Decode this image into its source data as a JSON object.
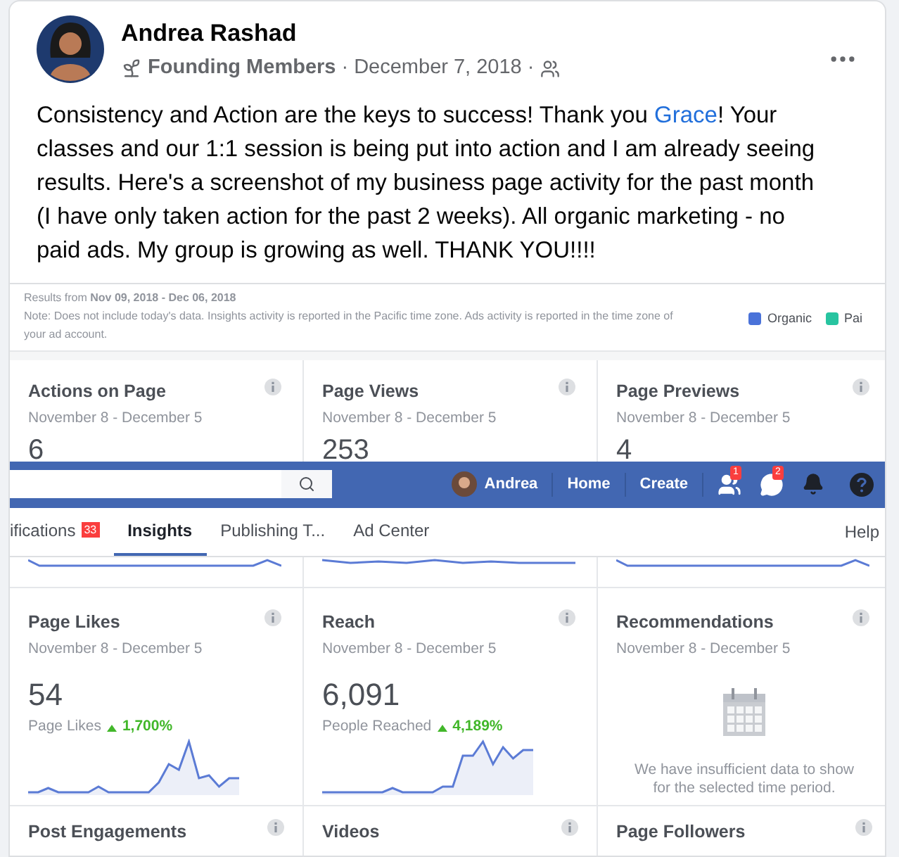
{
  "post": {
    "author": "Andrea Rashad",
    "group": "Founding Members",
    "separator_1": "·",
    "date": "December 7, 2018",
    "separator_2": "·",
    "body_before": "Consistency and Action are the keys to success! Thank you ",
    "mention": "Grace",
    "body_after": "! Your classes and our 1:1 session is being put into action and I am already seeing results. Here's a screenshot of my business page activity for the past month (I have only taken action for the past 2 weeks). All organic marketing - no paid ads. My group is growing as well. THANK YOU!!!!"
  },
  "screenshot": {
    "results": "Results from **Nov 09, 2018 - Dec 06, 2018**",
    "note": "Note: Does not include today's data. Insights activity is reported in the Pacific time zone. Ads activity is reported in the time zone of your ad account.",
    "legend": [
      {
        "label": "Organic",
        "color": "#4a72d9"
      },
      {
        "label": "Pai",
        "color": "#27c4a0"
      }
    ],
    "top_cards": [
      {
        "title": "Actions on Page",
        "dates": "November 8 - December 5",
        "value": "6"
      },
      {
        "title": "Page Views",
        "dates": "November 8 - December 5",
        "value": "253"
      },
      {
        "title": "Page Previews",
        "dates": "November 8 - December 5",
        "value": "4"
      }
    ],
    "navbar": {
      "user": "Andrea",
      "links": [
        "Home",
        "Create"
      ],
      "friends_badge": "1",
      "messages_badge": "2"
    },
    "tabs": [
      {
        "label": "ifications",
        "badge": "33",
        "selected": false
      },
      {
        "label": "Insights",
        "selected": true
      },
      {
        "label": "Publishing T...",
        "selected": false
      },
      {
        "label": "Ad Center",
        "selected": false
      }
    ],
    "help": "Help",
    "cards": [
      {
        "kind": "stat",
        "title": "Page Likes",
        "dates": "November 8 - December 5",
        "value": "54",
        "caption": "Page Likes",
        "change": "1,700%"
      },
      {
        "kind": "stat",
        "title": "Reach",
        "dates": "November 8 - December 5",
        "value": "6,091",
        "caption": "People Reached",
        "change": "4,189%"
      },
      {
        "kind": "empty",
        "title": "Recommendations",
        "dates": "November 8 - December 5",
        "message": "We have insufficient data to show for the selected time period."
      }
    ],
    "bottom_cards": [
      {
        "title": "Post Engagements"
      },
      {
        "title": "Videos"
      },
      {
        "title": "Page Followers"
      }
    ]
  }
}
